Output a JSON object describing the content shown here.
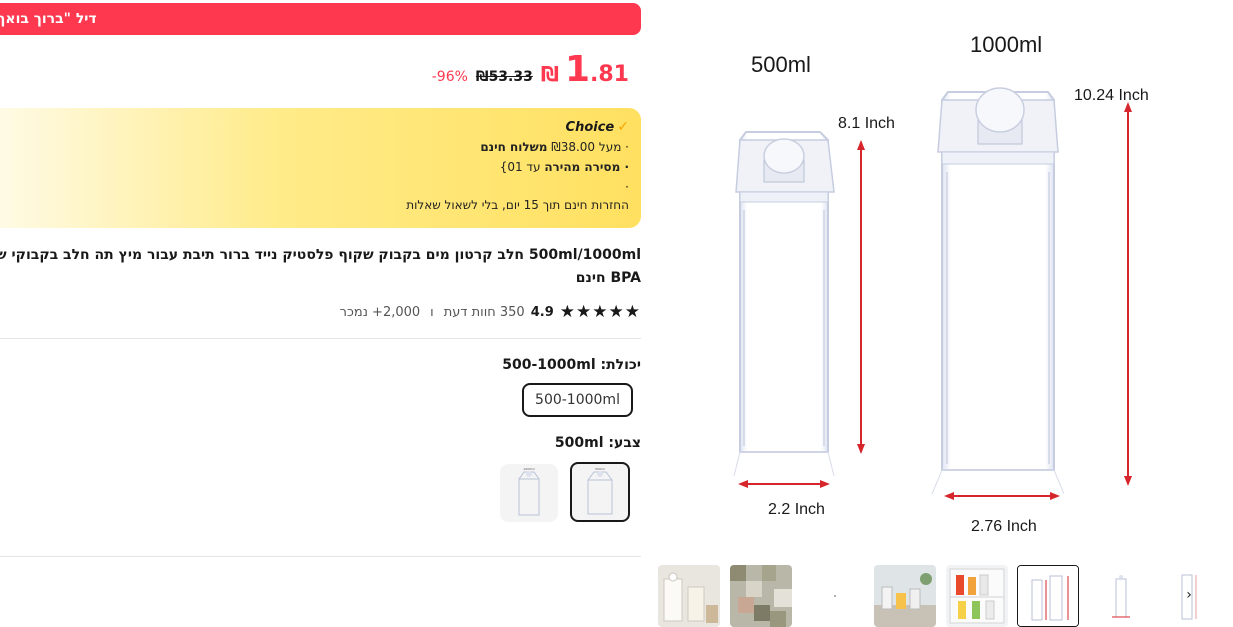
{
  "deal": {
    "label": "דיל \"ברוך בואך\""
  },
  "price": {
    "currency": "₪",
    "integer": "1",
    "decimal": ".81",
    "original": "₪53.33",
    "discount": "96%-"
  },
  "choice": {
    "brand": "Choice",
    "line1_prefix": "· מעל ₪38.00 ",
    "line1_bold": "משלוח חינם",
    "line2_bold": "· מסירה מהירה",
    "line2_rest": " עד 01}",
    "line3": "·",
    "line4": "החזרות חינם תוך 15 יום, בלי לשאול שאלות"
  },
  "product": {
    "title_line1": "500ml/1000ml חלב קרטון מים בקבוק שקוף פלסטיק נייד ברור תיבת עבור מיץ תה חלב בקבוקי שתייה כוס",
    "title_line2": "BPA חינם",
    "rating": "4.9",
    "reviews": "350 חוות דעת",
    "sold": "2,000+ נמכר",
    "separator": "ו"
  },
  "options": {
    "capacity_label": "יכולת: 500-1000ml",
    "capacity_value": "500-1000ml",
    "color_label": "צבע: 500ml"
  },
  "gallery": {
    "label_500": "500ml",
    "label_1000": "1000ml",
    "height_500": "8.1 Inch",
    "height_1000": "10.24 Inch",
    "width_500": "2.2 Inch",
    "width_1000": "2.76 Inch"
  },
  "icons": {
    "star": "star-icon",
    "check": "check-icon",
    "arrow": "chevron-right-icon"
  },
  "colors": {
    "accent": "#fd384f",
    "choice_yellow": "#ffe060",
    "dimension_red": "#d6262c"
  }
}
